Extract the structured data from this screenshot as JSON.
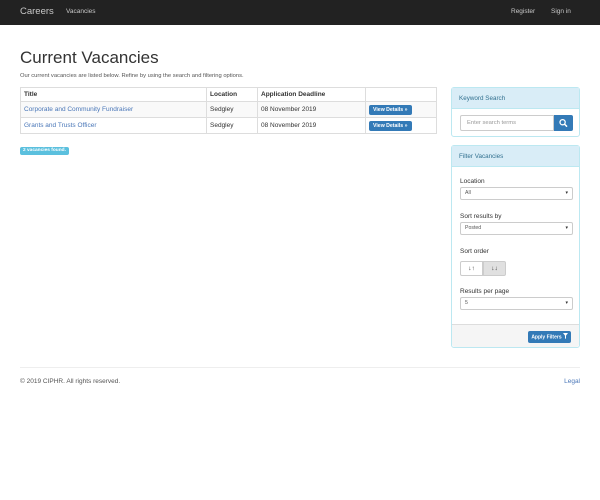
{
  "navbar": {
    "brand": "Careers",
    "vacancies_link": "Vacancies",
    "register_link": "Register",
    "signin_link": "Sign in"
  },
  "page": {
    "title": "Current Vacancies",
    "lead": "Our current vacancies are listed below. Refine by using the search and filtering options."
  },
  "table": {
    "headers": [
      "Title",
      "Location",
      "Application Deadline",
      ""
    ],
    "rows": [
      {
        "title": "Corporate and Community Fundraiser",
        "location": "Sedgley",
        "deadline": "08 November 2019",
        "action": "View Details »"
      },
      {
        "title": "Grants and Trusts Officer",
        "location": "Sedgley",
        "deadline": "08 November 2019",
        "action": "View Details »"
      }
    ]
  },
  "results_badge": "2 vacancies found.",
  "keyword_search": {
    "heading": "Keyword Search",
    "placeholder": "Enter search terms"
  },
  "filter": {
    "heading": "Filter Vacancies",
    "location_label": "Location",
    "location_value": "All",
    "sort_by_label": "Sort results by",
    "sort_by_value": "Posted",
    "sort_order_label": "Sort order",
    "sort_asc_glyph": "↓↑",
    "sort_desc_glyph": "↓↓",
    "per_page_label": "Results per page",
    "per_page_value": "5",
    "apply_label": "Apply Filters"
  },
  "footer": {
    "copyright": "© 2019 CIPHR. All rights reserved.",
    "legal": "Legal"
  },
  "colors": {
    "navbar": "#222222",
    "primary": "#337ab7",
    "info": "#5bc0de",
    "panel_heading": "#d9edf7",
    "link": "#4a77b8"
  },
  "icons": {
    "search": "search-icon",
    "filter": "filter-icon"
  }
}
